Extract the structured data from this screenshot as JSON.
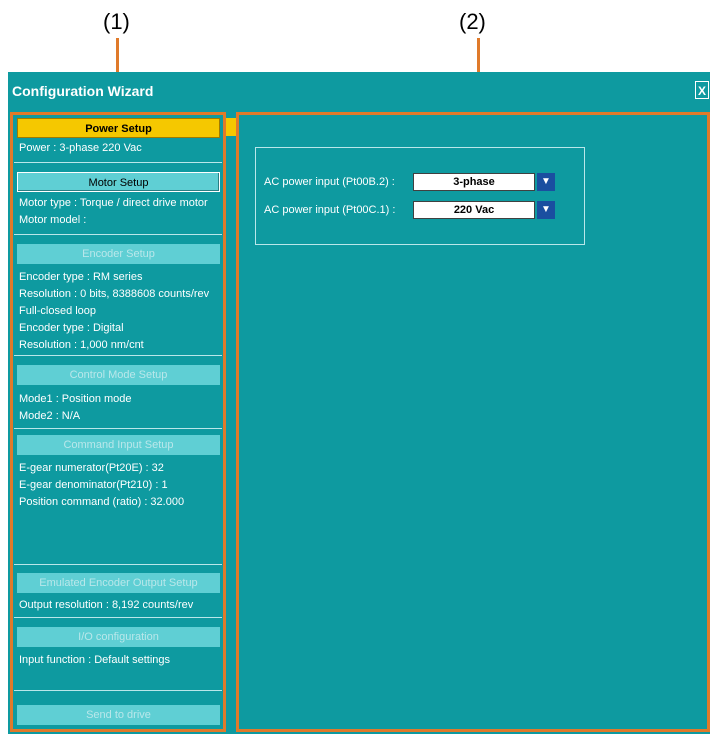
{
  "callouts": {
    "left": "(1)",
    "right": "(2)"
  },
  "window": {
    "title": "Configuration Wizard",
    "close_label": "X"
  },
  "steps": {
    "power": {
      "label": "Power Setup",
      "info": [
        "Power : 3-phase 220 Vac"
      ]
    },
    "motor": {
      "label": "Motor Setup",
      "info": [
        "Motor type : Torque / direct drive motor",
        "Motor model  :"
      ]
    },
    "encoder": {
      "label": "Encoder Setup",
      "info": [
        "Encoder type : RM series",
        "Resolution : 0 bits, 8388608 counts/rev",
        "Full-closed loop",
        "Encoder type : Digital",
        "Resolution : 1,000 nm/cnt"
      ]
    },
    "control": {
      "label": "Control Mode Setup",
      "info": [
        "Mode1 : Position mode",
        "Mode2 : N/A"
      ]
    },
    "command": {
      "label": "Command Input Setup",
      "info": [
        "E-gear numerator(Pt20E) : 32",
        "E-gear denominator(Pt210) : 1",
        "Position command (ratio) : 32.000"
      ]
    },
    "emulated": {
      "label": "Emulated Encoder Output Setup",
      "info": [
        "Output resolution : 8,192 counts/rev"
      ]
    },
    "io": {
      "label": "I/O configuration",
      "info": [
        "Input function : Default settings"
      ]
    },
    "send": {
      "label": "Send to drive"
    }
  },
  "power_settings": {
    "phase": {
      "label": "AC power input (Pt00B.2) :",
      "value": "3-phase"
    },
    "voltage": {
      "label": "AC power input (Pt00C.1) :",
      "value": "220 Vac"
    }
  },
  "colors": {
    "background": "#0e9aa0",
    "accent": "#f5c800",
    "highlight": "#e07a2a",
    "dropdown": "#1a4fa0"
  }
}
